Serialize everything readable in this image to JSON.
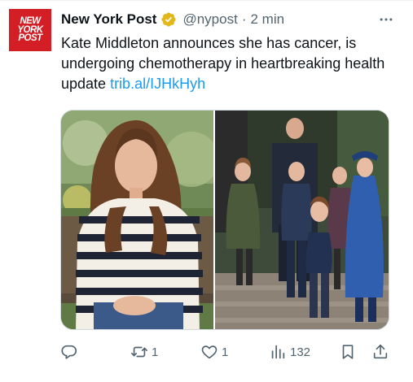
{
  "account": {
    "avatar_lines": [
      "NEW",
      "YORK",
      "POST"
    ],
    "name": "New York Post",
    "handle": "@nypost",
    "separator": "·",
    "time": "2 min",
    "verified": true,
    "badge_color": "#e2b719"
  },
  "tweet": {
    "text": "Kate Middleton announces she has cancer, is undergoing chemotherapy in heartbreaking health update ",
    "link": "trib.al/IJHkHyh"
  },
  "actions": {
    "reply_count": "",
    "retweet_count": "1",
    "like_count": "1",
    "views_count": "132"
  },
  "colors": {
    "brand_red": "#d31e25",
    "link": "#1d9bf0",
    "secondary_text": "#536471"
  },
  "icons": {
    "more": "more-icon",
    "reply": "reply-icon",
    "retweet": "retweet-icon",
    "like": "heart-icon",
    "views": "views-icon",
    "bookmark": "bookmark-icon",
    "share": "share-icon"
  }
}
